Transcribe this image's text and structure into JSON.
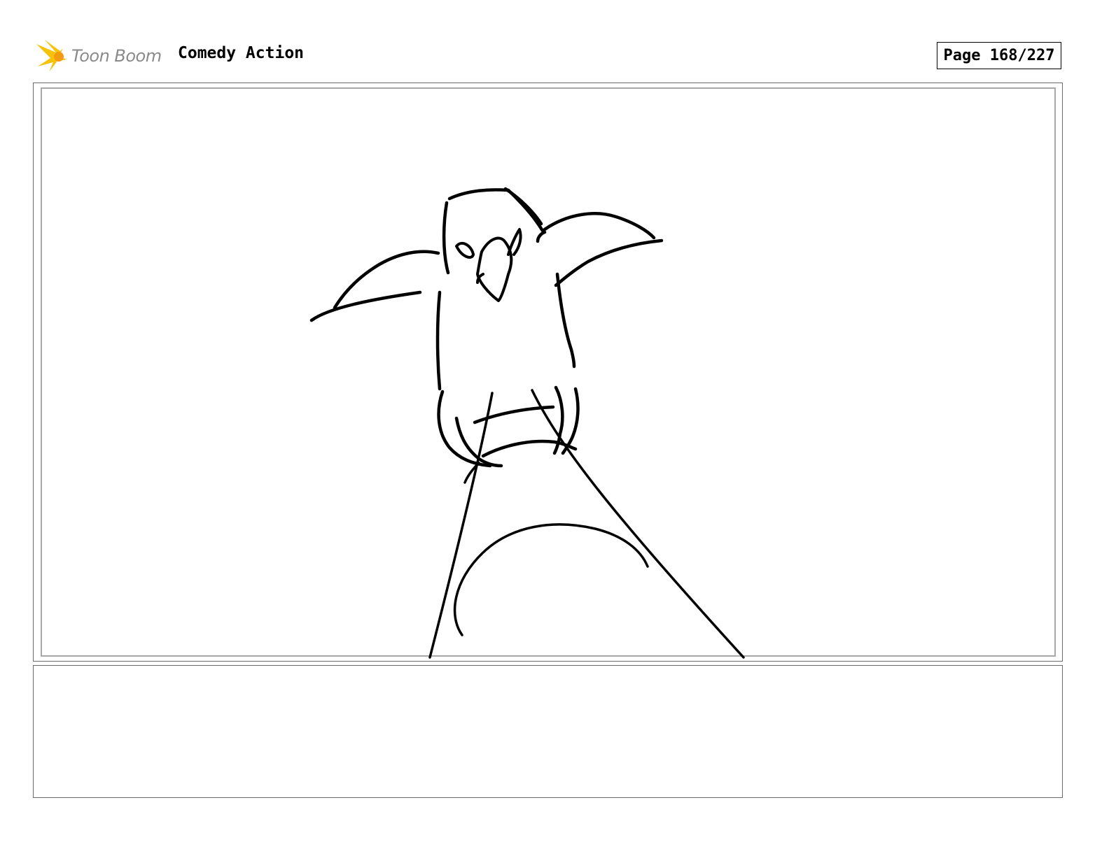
{
  "header": {
    "logo_text": "Toon Boom",
    "project_title": "Comedy Action",
    "page_label": "Page 168/227"
  },
  "panel": {
    "image": "bird-sketch"
  },
  "notes": {
    "text": ""
  },
  "colors": {
    "logo_accent": "#f4b400",
    "logo_text": "#8a8a8a",
    "frame": "#6a6a6a",
    "inner_frame": "#a8a8a8"
  }
}
